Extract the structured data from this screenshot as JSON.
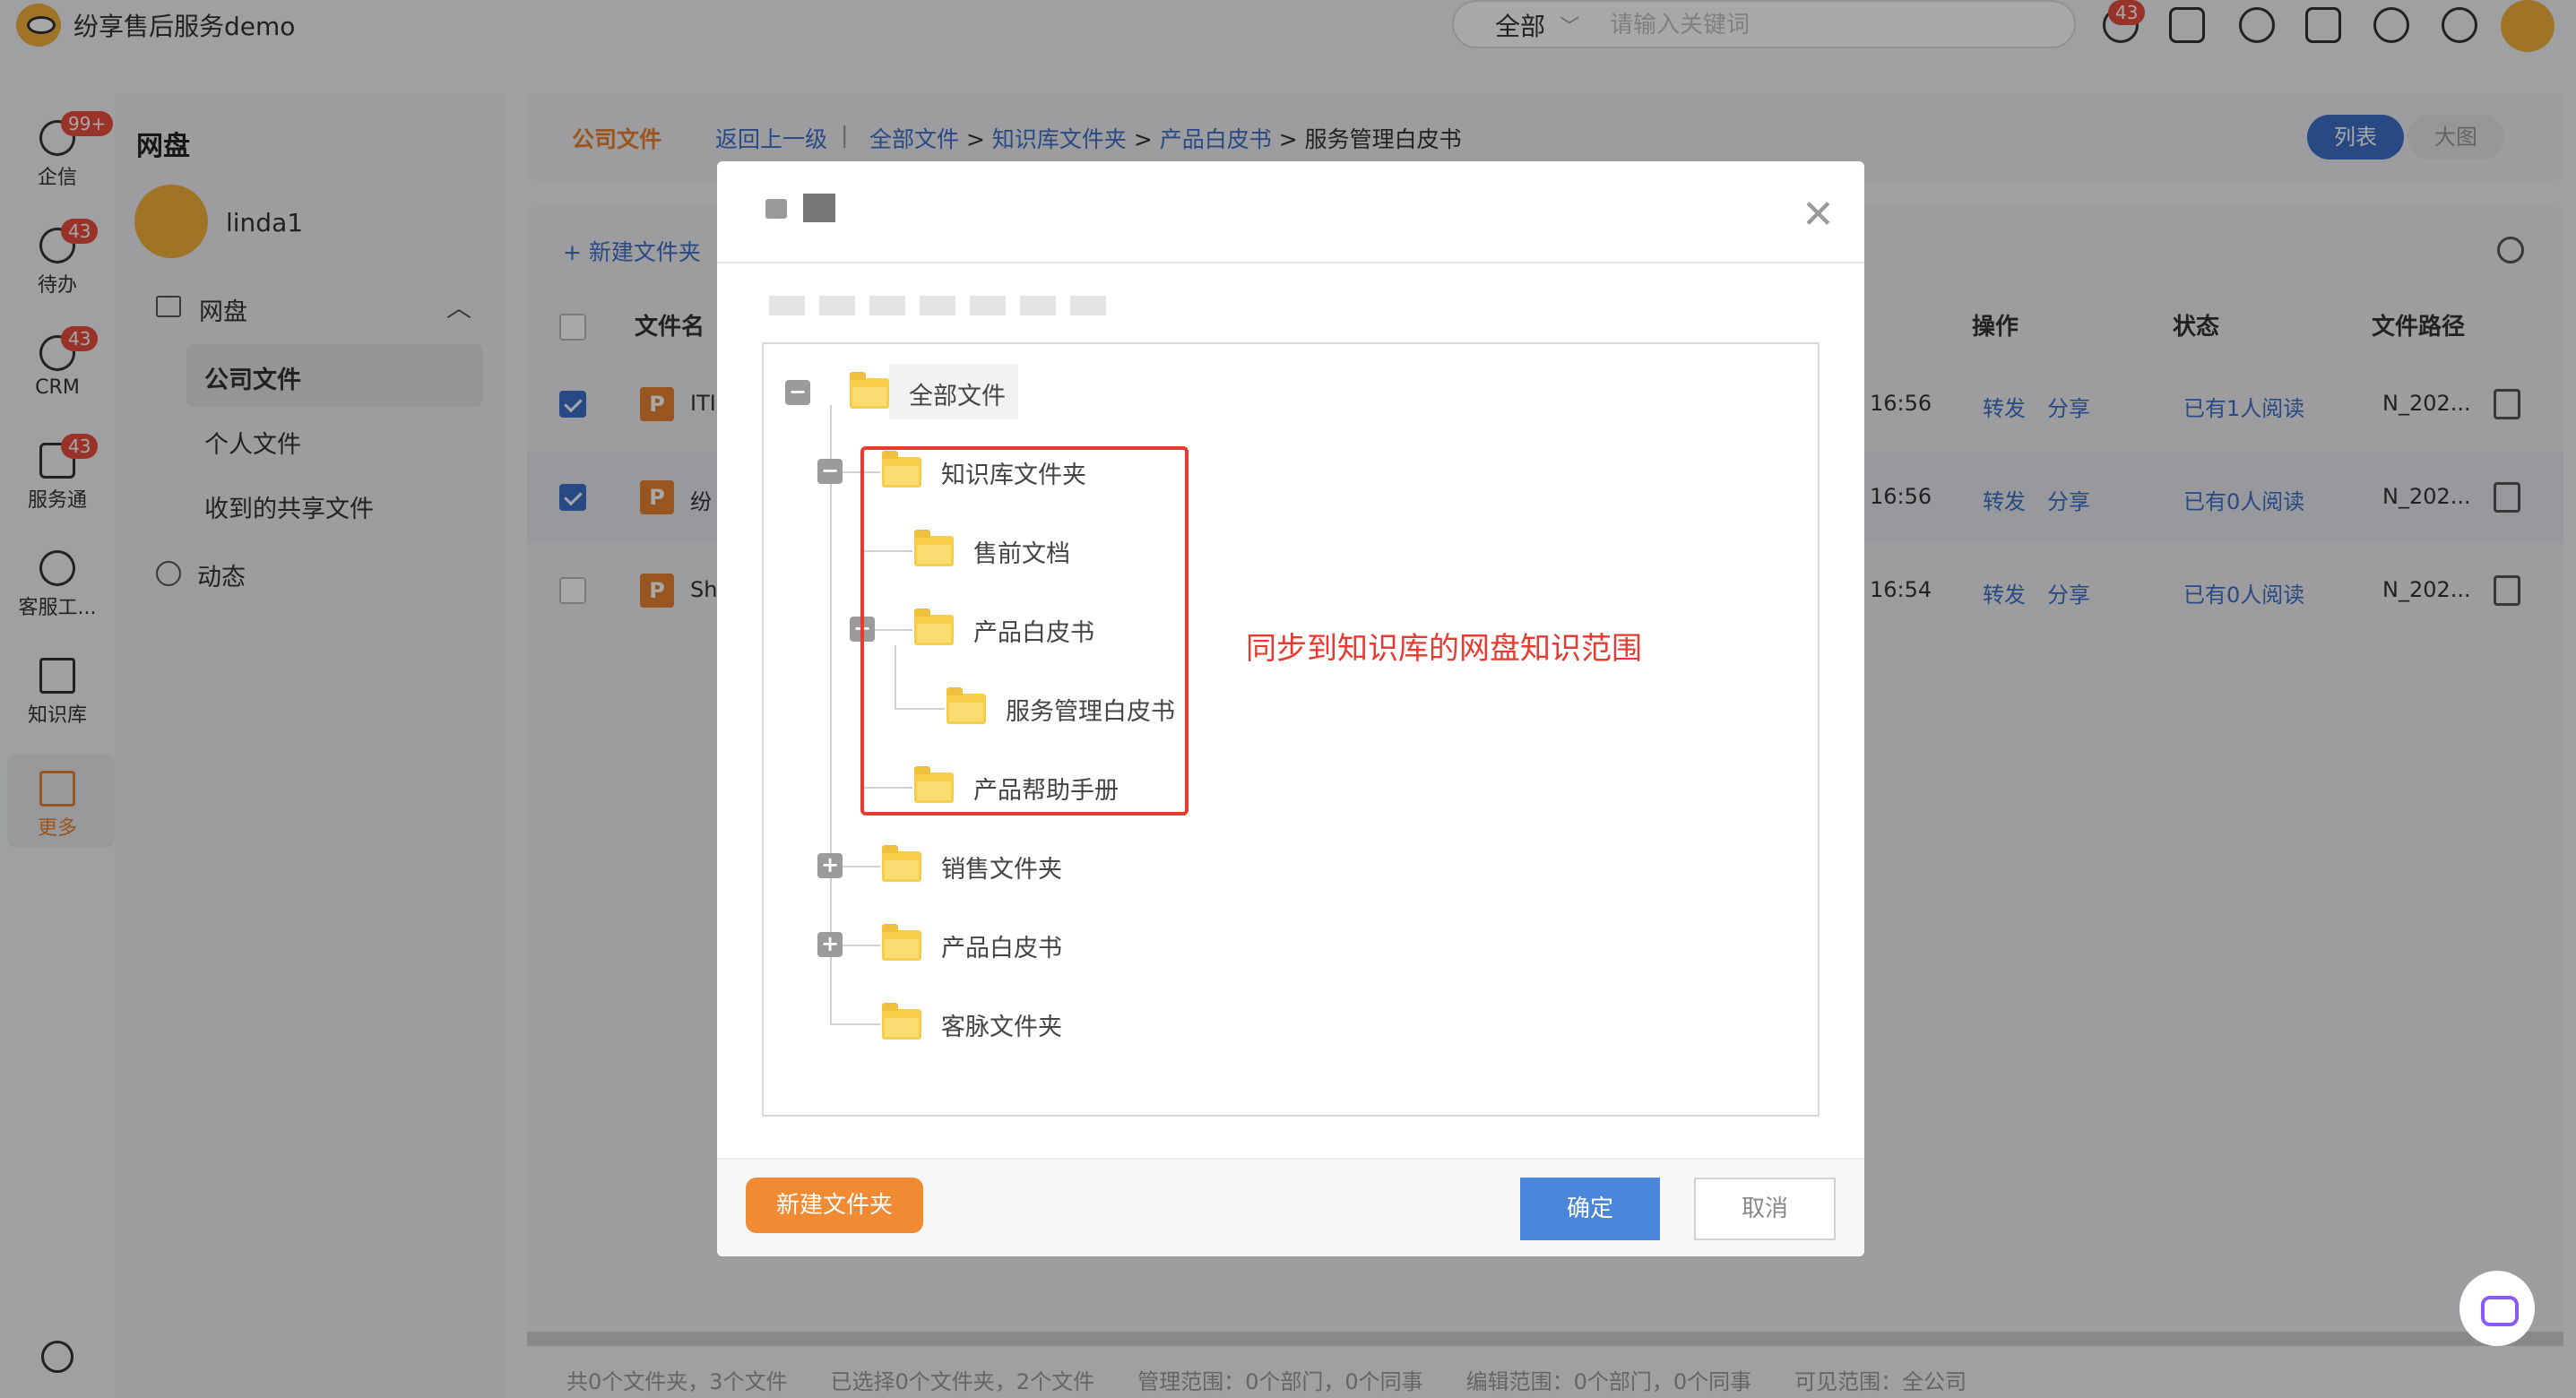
{
  "app": {
    "title": "纷享售后服务demo"
  },
  "search": {
    "scope": "全部",
    "placeholder": "请输入关键词"
  },
  "top_badge": "43",
  "rail": [
    {
      "label": "企信",
      "badge": "99+"
    },
    {
      "label": "待办",
      "badge": "43"
    },
    {
      "label": "CRM",
      "badge": "43"
    },
    {
      "label": "服务通",
      "badge": "43"
    },
    {
      "label": "客服工..."
    },
    {
      "label": "知识库"
    },
    {
      "label": "更多"
    }
  ],
  "sidebar": {
    "title": "网盘",
    "user": "linda1",
    "section": "网盘",
    "items": [
      "公司文件",
      "个人文件",
      "收到的共享文件"
    ],
    "dynamic": "动态"
  },
  "breadcrumb": {
    "current_tab": "公司文件",
    "back": "返回上一级",
    "sep": "|",
    "path": [
      "全部文件",
      "知识库文件夹",
      "产品白皮书",
      "服务管理白皮书"
    ],
    "arrow": ">"
  },
  "view": {
    "list": "列表",
    "grid": "大图"
  },
  "toolbar": {
    "new_folder": "+ 新建文件夹"
  },
  "table": {
    "headers": {
      "name": "文件名",
      "action": "操作",
      "status": "状态",
      "path": "文件路径"
    },
    "rows": [
      {
        "checked": true,
        "icon": "P",
        "name": "ITI",
        "time": "16:56",
        "forward": "转发",
        "share": "分享",
        "status": "已有1人阅读",
        "path": "N_202..."
      },
      {
        "checked": true,
        "icon": "P",
        "name": "纷",
        "time": "16:56",
        "forward": "转发",
        "share": "分享",
        "status": "已有0人阅读",
        "path": "N_202..."
      },
      {
        "checked": false,
        "icon": "P",
        "name": "Sh",
        "time": "16:54",
        "forward": "转发",
        "share": "分享",
        "status": "已有0人阅读",
        "path": "N_202..."
      }
    ]
  },
  "footer": {
    "text": "共0个文件夹，3个文件　　已选择0个文件夹，2个文件　　管理范围：0个部门，0个同事　　编辑范围：0个部门，0个同事　　可见范围：全公司"
  },
  "modal": {
    "tree": {
      "root": "全部文件",
      "kb": "知识库文件夹",
      "presale": "售前文档",
      "whitepaper": "产品白皮书",
      "svc_whitepaper": "服务管理白皮书",
      "manual": "产品帮助手册",
      "sales": "销售文件夹",
      "whitepaper2": "产品白皮书",
      "client": "客脉文件夹"
    },
    "annotation": "同步到知识库的网盘知识范围",
    "new_folder_btn": "新建文件夹",
    "ok_btn": "确定",
    "cancel_btn": "取消"
  },
  "glyphs": {
    "minus": "−",
    "plus": "+",
    "close": "✕",
    "chevron_up": "︿",
    "chevron_down": "﹀"
  },
  "colors": {
    "accent_blue": "#3d6fc9",
    "accent_orange": "#f08b33",
    "highlight_red": "#e63b30",
    "folder": "#f7cd4a"
  }
}
